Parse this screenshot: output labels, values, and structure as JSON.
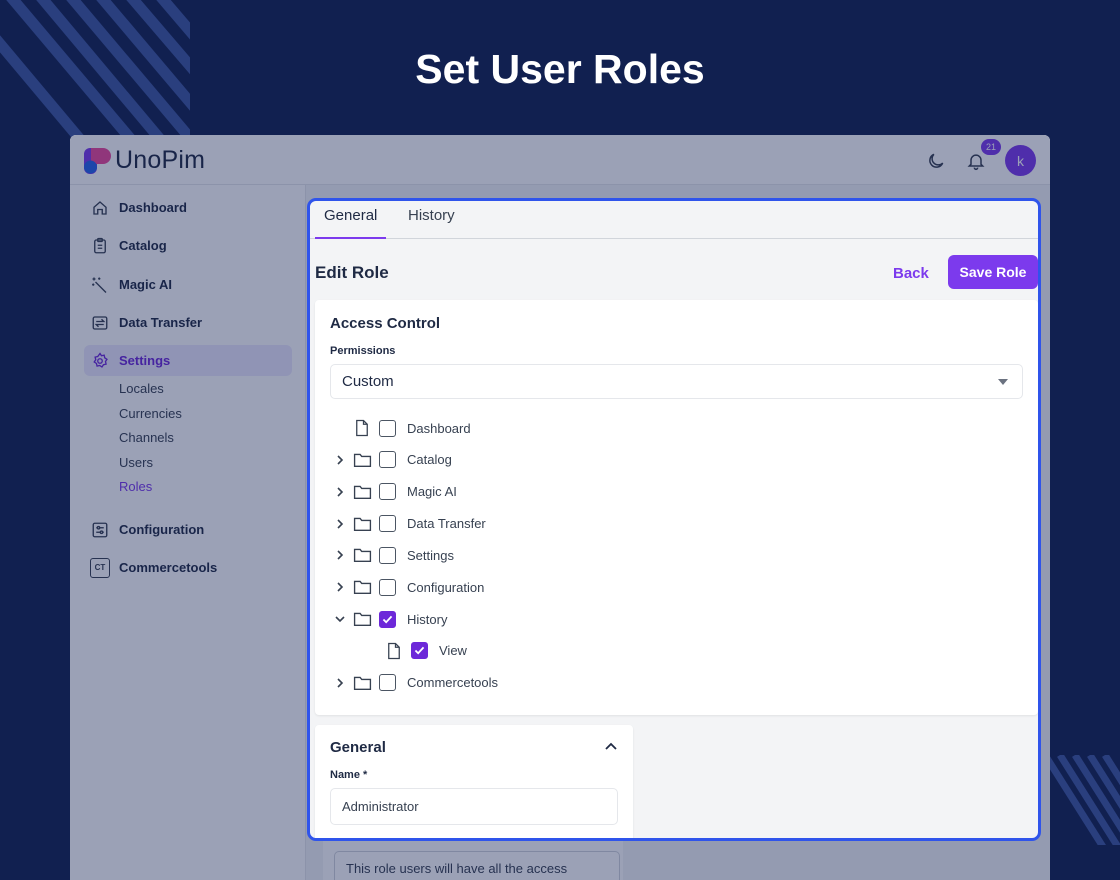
{
  "banner": {
    "title": "Set User Roles"
  },
  "colors": {
    "background": "#112050",
    "accent": "#7c3aed",
    "highlight_border": "#2f54eb"
  },
  "header": {
    "logo_text": "UnoPim",
    "notification_count": "21",
    "avatar_initial": "k",
    "icons": [
      "moon-icon",
      "bell-icon"
    ]
  },
  "sidebar": {
    "items": [
      {
        "label": "Dashboard",
        "icon": "home-icon"
      },
      {
        "label": "Catalog",
        "icon": "clipboard-icon"
      },
      {
        "label": "Magic AI",
        "icon": "magic-wand-icon"
      },
      {
        "label": "Data Transfer",
        "icon": "transfer-icon"
      },
      {
        "label": "Settings",
        "icon": "gear-icon",
        "active": true
      },
      {
        "label": "Configuration",
        "icon": "sliders-icon"
      },
      {
        "label": "Commercetools",
        "icon": "ct-icon",
        "icon_text": "CT"
      }
    ],
    "sub_items": [
      {
        "label": "Locales"
      },
      {
        "label": "Currencies"
      },
      {
        "label": "Channels"
      },
      {
        "label": "Users"
      },
      {
        "label": "Roles",
        "active": true
      }
    ]
  },
  "tabs": [
    {
      "label": "General",
      "active": true
    },
    {
      "label": "History",
      "active": false
    }
  ],
  "page": {
    "title": "Edit Role",
    "back_label": "Back",
    "save_label": "Save Role"
  },
  "access_control": {
    "title": "Access Control",
    "permissions_label": "Permissions",
    "permissions_value": "Custom",
    "tree": [
      {
        "label": "Dashboard",
        "type": "file",
        "checked": false,
        "expandable": false,
        "expanded": false,
        "level": 0
      },
      {
        "label": "Catalog",
        "type": "folder",
        "checked": false,
        "expandable": true,
        "expanded": false,
        "level": 0
      },
      {
        "label": "Magic AI",
        "type": "folder",
        "checked": false,
        "expandable": true,
        "expanded": false,
        "level": 0
      },
      {
        "label": "Data Transfer",
        "type": "folder",
        "checked": false,
        "expandable": true,
        "expanded": false,
        "level": 0
      },
      {
        "label": "Settings",
        "type": "folder",
        "checked": false,
        "expandable": true,
        "expanded": false,
        "level": 0
      },
      {
        "label": "Configuration",
        "type": "folder",
        "checked": false,
        "expandable": true,
        "expanded": false,
        "level": 0
      },
      {
        "label": "History",
        "type": "folder",
        "checked": true,
        "expandable": true,
        "expanded": true,
        "level": 0
      },
      {
        "label": "View",
        "type": "file",
        "checked": true,
        "expandable": false,
        "expanded": false,
        "level": 1
      },
      {
        "label": "Commercetools",
        "type": "folder",
        "checked": false,
        "expandable": true,
        "expanded": false,
        "level": 0
      }
    ]
  },
  "general": {
    "title": "General",
    "name_label": "Name *",
    "name_value": "Administrator",
    "description_value": "This role users will have all the access"
  }
}
